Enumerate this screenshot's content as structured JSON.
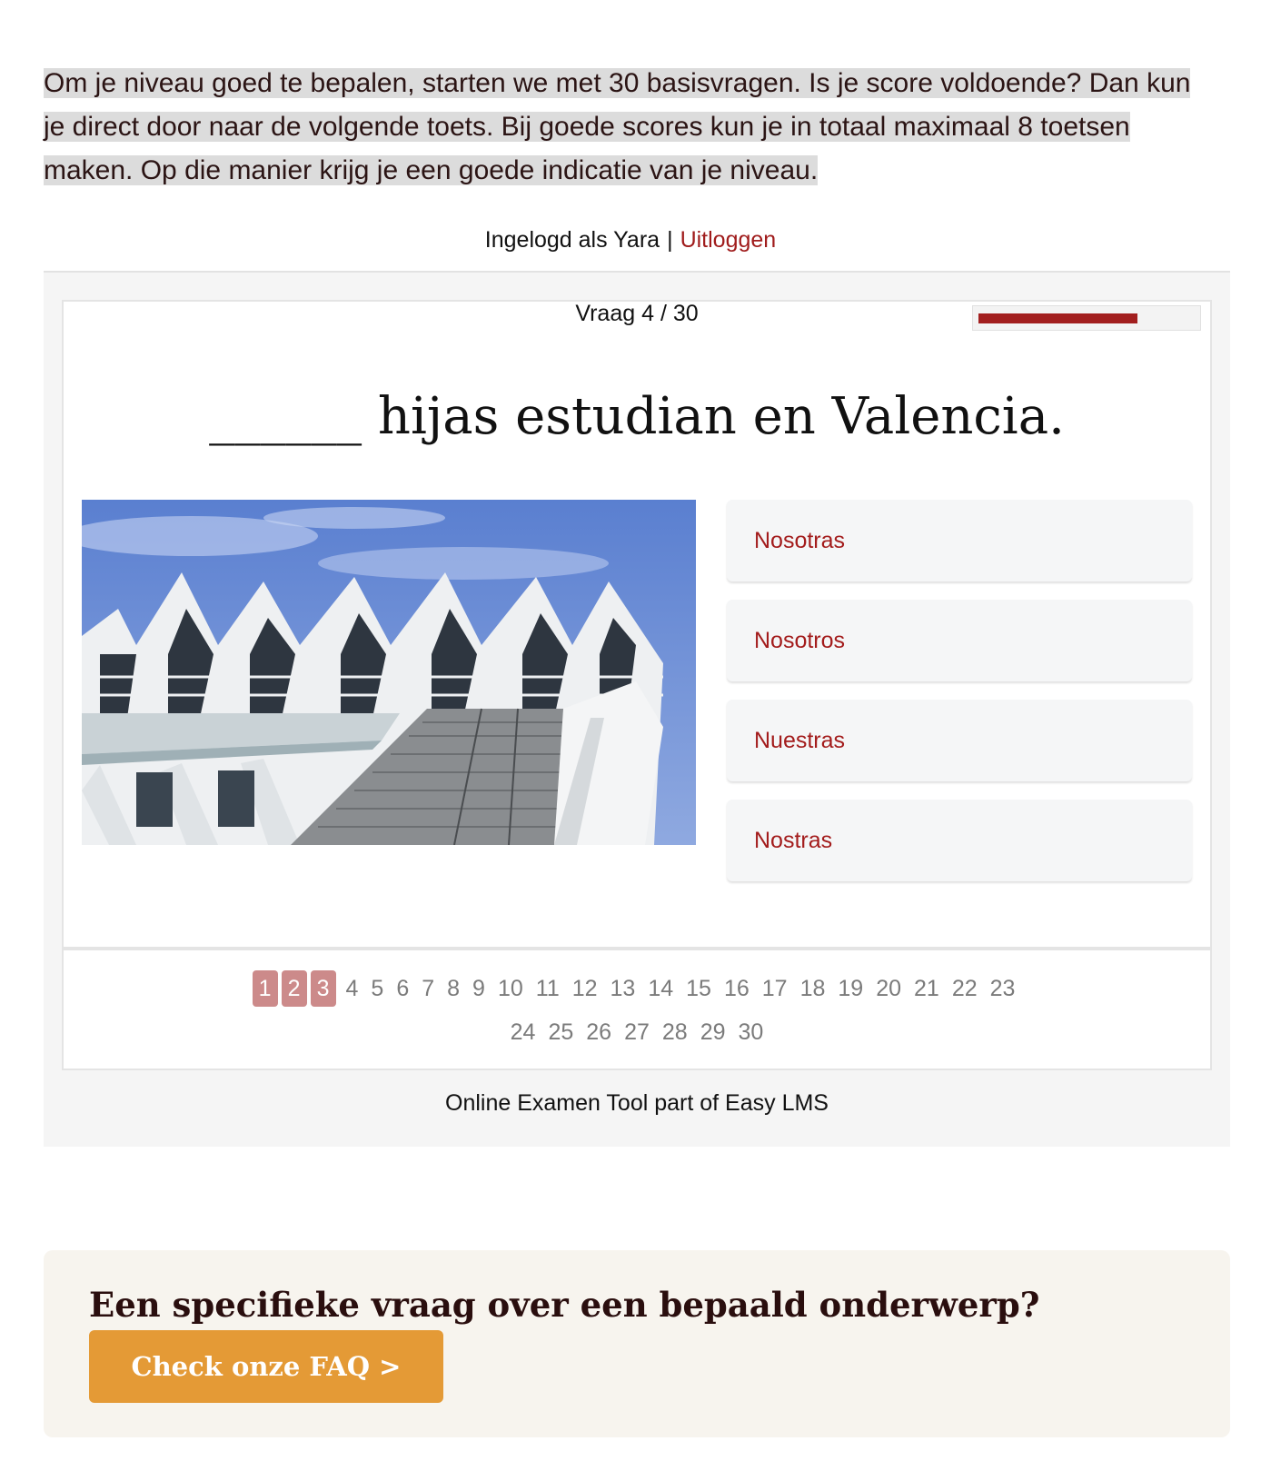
{
  "intro": {
    "text": "Om je niveau goed te bepalen, starten we met 30 basisvragen. Is je score voldoende? Dan kun je direct door naar de volgende toets. Bij goede scores kun je in totaal maximaal 8 toetsen maken. Op die manier krijg je een goede indicatie van je niveau."
  },
  "login": {
    "label": "Ingelogd als Yara",
    "separator": "|",
    "logout": "Uitloggen"
  },
  "quiz": {
    "counter": "Vraag 4 / 30",
    "progress_fraction": 0.73,
    "question": "______ hijas estudian en Valencia.",
    "answers": [
      "Nosotras",
      "Nosotros",
      "Nuestras",
      "Nostras"
    ],
    "pages_row1": [
      "1",
      "2",
      "3",
      "4",
      "5",
      "6",
      "7",
      "8",
      "9",
      "10",
      "11",
      "12",
      "13",
      "14",
      "15",
      "16",
      "17",
      "18",
      "19",
      "20",
      "21",
      "22",
      "23"
    ],
    "pages_row2": [
      "24",
      "25",
      "26",
      "27",
      "28",
      "29",
      "30"
    ],
    "answered_pages": [
      "1",
      "2",
      "3"
    ],
    "footer": "Online Examen Tool part of Easy LMS"
  },
  "faq": {
    "title": "Een specifieke vraag over een bepaald onderwerp?",
    "button": "Check onze FAQ >"
  },
  "colors": {
    "accent": "#a31c1c",
    "progress": "#a21f1f",
    "answered_page": "#cc8a8a",
    "faq_button": "#e49a36",
    "faq_bg": "#f7f4ee"
  }
}
